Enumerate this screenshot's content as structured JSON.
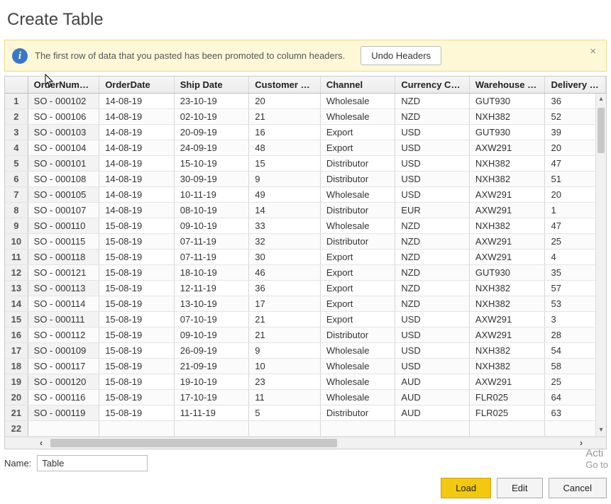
{
  "dialog": {
    "title": "Create Table"
  },
  "infobar": {
    "text": "The first row of data that you pasted has been promoted to column headers.",
    "undo_label": "Undo Headers",
    "close_glyph": "×"
  },
  "columns": [
    "OrderNumber",
    "OrderDate",
    "Ship Date",
    "Customer Na...",
    "Channel",
    "Currency Code",
    "Warehouse C...",
    "Delivery Regi."
  ],
  "rows": [
    {
      "n": "1",
      "ordern": "SO - 000102",
      "orderdate": "14-08-19",
      "ship": "23-10-19",
      "cust": "20",
      "chan": "Wholesale",
      "curr": "NZD",
      "wh": "GUT930",
      "del": "36"
    },
    {
      "n": "2",
      "ordern": "SO - 000106",
      "orderdate": "14-08-19",
      "ship": "02-10-19",
      "cust": "21",
      "chan": "Wholesale",
      "curr": "NZD",
      "wh": "NXH382",
      "del": "52"
    },
    {
      "n": "3",
      "ordern": "SO - 000103",
      "orderdate": "14-08-19",
      "ship": "20-09-19",
      "cust": "16",
      "chan": "Export",
      "curr": "USD",
      "wh": "GUT930",
      "del": "39"
    },
    {
      "n": "4",
      "ordern": "SO - 000104",
      "orderdate": "14-08-19",
      "ship": "24-09-19",
      "cust": "48",
      "chan": "Export",
      "curr": "USD",
      "wh": "AXW291",
      "del": "20"
    },
    {
      "n": "5",
      "ordern": "SO - 000101",
      "orderdate": "14-08-19",
      "ship": "15-10-19",
      "cust": "15",
      "chan": "Distributor",
      "curr": "USD",
      "wh": "NXH382",
      "del": "47"
    },
    {
      "n": "6",
      "ordern": "SO - 000108",
      "orderdate": "14-08-19",
      "ship": "30-09-19",
      "cust": "9",
      "chan": "Distributor",
      "curr": "USD",
      "wh": "NXH382",
      "del": "51"
    },
    {
      "n": "7",
      "ordern": "SO - 000105",
      "orderdate": "14-08-19",
      "ship": "10-11-19",
      "cust": "49",
      "chan": "Wholesale",
      "curr": "USD",
      "wh": "AXW291",
      "del": "20"
    },
    {
      "n": "8",
      "ordern": "SO - 000107",
      "orderdate": "14-08-19",
      "ship": "08-10-19",
      "cust": "14",
      "chan": "Distributor",
      "curr": "EUR",
      "wh": "AXW291",
      "del": "1"
    },
    {
      "n": "9",
      "ordern": "SO - 000110",
      "orderdate": "15-08-19",
      "ship": "09-10-19",
      "cust": "33",
      "chan": "Wholesale",
      "curr": "NZD",
      "wh": "NXH382",
      "del": "47"
    },
    {
      "n": "10",
      "ordern": "SO - 000115",
      "orderdate": "15-08-19",
      "ship": "07-11-19",
      "cust": "32",
      "chan": "Distributor",
      "curr": "NZD",
      "wh": "AXW291",
      "del": "25"
    },
    {
      "n": "11",
      "ordern": "SO - 000118",
      "orderdate": "15-08-19",
      "ship": "07-11-19",
      "cust": "30",
      "chan": "Export",
      "curr": "NZD",
      "wh": "AXW291",
      "del": "4"
    },
    {
      "n": "12",
      "ordern": "SO - 000121",
      "orderdate": "15-08-19",
      "ship": "18-10-19",
      "cust": "46",
      "chan": "Export",
      "curr": "NZD",
      "wh": "GUT930",
      "del": "35"
    },
    {
      "n": "13",
      "ordern": "SO - 000113",
      "orderdate": "15-08-19",
      "ship": "12-11-19",
      "cust": "36",
      "chan": "Export",
      "curr": "NZD",
      "wh": "NXH382",
      "del": "57"
    },
    {
      "n": "14",
      "ordern": "SO - 000114",
      "orderdate": "15-08-19",
      "ship": "13-10-19",
      "cust": "17",
      "chan": "Export",
      "curr": "NZD",
      "wh": "NXH382",
      "del": "53"
    },
    {
      "n": "15",
      "ordern": "SO - 000111",
      "orderdate": "15-08-19",
      "ship": "07-10-19",
      "cust": "21",
      "chan": "Export",
      "curr": "USD",
      "wh": "AXW291",
      "del": "3"
    },
    {
      "n": "16",
      "ordern": "SO - 000112",
      "orderdate": "15-08-19",
      "ship": "09-10-19",
      "cust": "21",
      "chan": "Distributor",
      "curr": "USD",
      "wh": "AXW291",
      "del": "28"
    },
    {
      "n": "17",
      "ordern": "SO - 000109",
      "orderdate": "15-08-19",
      "ship": "26-09-19",
      "cust": "9",
      "chan": "Wholesale",
      "curr": "USD",
      "wh": "NXH382",
      "del": "54"
    },
    {
      "n": "18",
      "ordern": "SO - 000117",
      "orderdate": "15-08-19",
      "ship": "21-09-19",
      "cust": "10",
      "chan": "Wholesale",
      "curr": "USD",
      "wh": "NXH382",
      "del": "58"
    },
    {
      "n": "19",
      "ordern": "SO - 000120",
      "orderdate": "15-08-19",
      "ship": "19-10-19",
      "cust": "23",
      "chan": "Wholesale",
      "curr": "AUD",
      "wh": "AXW291",
      "del": "25"
    },
    {
      "n": "20",
      "ordern": "SO - 000116",
      "orderdate": "15-08-19",
      "ship": "17-10-19",
      "cust": "11",
      "chan": "Wholesale",
      "curr": "AUD",
      "wh": "FLR025",
      "del": "64"
    },
    {
      "n": "21",
      "ordern": "SO - 000119",
      "orderdate": "15-08-19",
      "ship": "11-11-19",
      "cust": "5",
      "chan": "Distributor",
      "curr": "AUD",
      "wh": "FLR025",
      "del": "63"
    }
  ],
  "extra_row_num": "22",
  "name_field": {
    "label": "Name:",
    "value": "Table"
  },
  "buttons": {
    "load": "Load",
    "edit": "Edit",
    "cancel": "Cancel"
  },
  "watermark": {
    "line1": "Acti",
    "line2": "Go to"
  },
  "scroll": {
    "left": "‹",
    "right": "›",
    "up": "▴",
    "down": "▾"
  }
}
